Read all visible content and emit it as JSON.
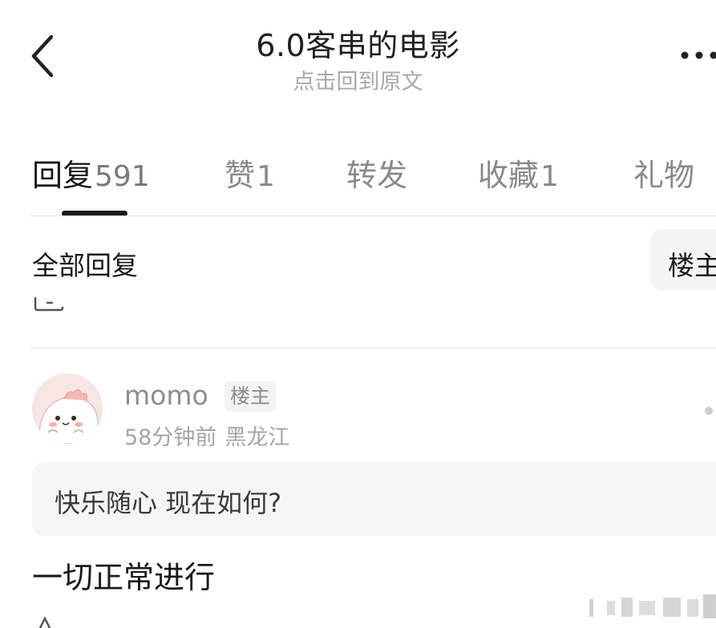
{
  "header": {
    "title": "6.0客串的电影",
    "subtitle": "点击回到原文"
  },
  "tabs": [
    {
      "label": "回复",
      "count": "591",
      "active": true
    },
    {
      "label": "赞",
      "count": "1"
    },
    {
      "label": "转发",
      "count": ""
    },
    {
      "label": "收藏",
      "count": "1"
    },
    {
      "label": "礼物",
      "count": ""
    }
  ],
  "filter": {
    "label": "全部回复",
    "op_filter": "楼主"
  },
  "comment": {
    "username": "momo",
    "badge": "楼主",
    "time": "58分钟前",
    "location": "黑龙江",
    "quote": "快乐随心 现在如何?",
    "text": "一切正常进行"
  }
}
